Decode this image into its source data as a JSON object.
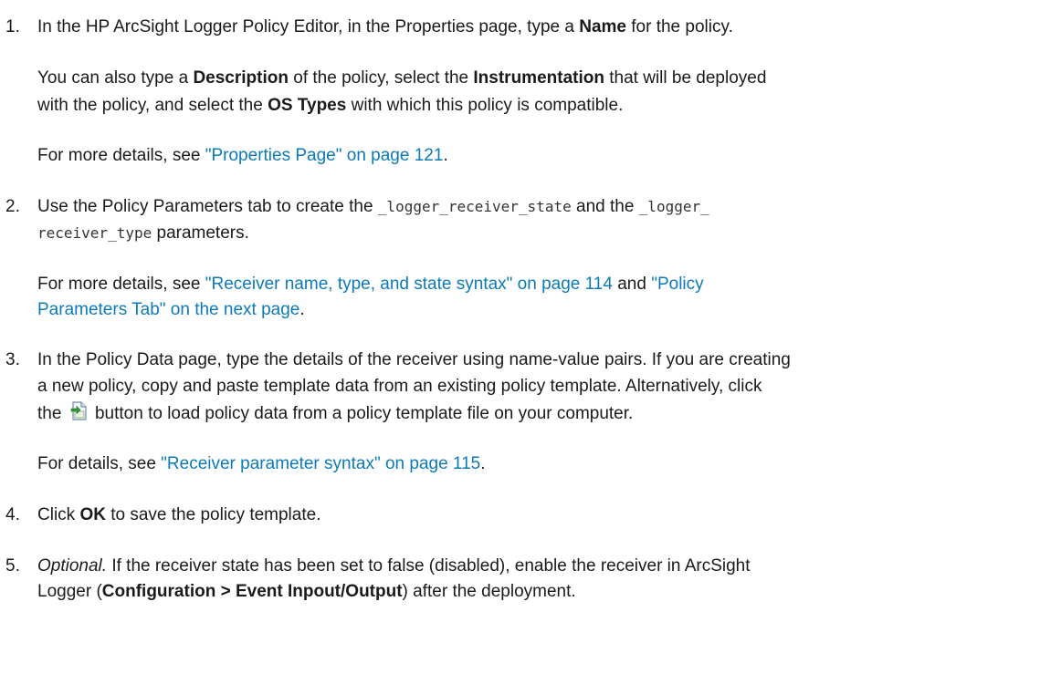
{
  "steps": [
    {
      "number": "1.",
      "line1": {
        "t1": "In the HP ArcSight Logger Policy Editor, in the Properties page, type a ",
        "b1": "Name",
        "t2": " for the policy."
      },
      "para2": {
        "l1_t1": "You can also type a ",
        "l1_b1": "Description",
        "l1_t2": " of the policy, select the ",
        "l1_b2": "Instrumentation",
        "l1_t3": " that will be deployed",
        "l2_t1": "with the policy, and select the ",
        "l2_b1": "OS Types",
        "l2_t2": " with which this policy is compatible."
      },
      "para3": {
        "t1": "For more details, see ",
        "link": "\"Properties Page\" on page 121",
        "t2": "."
      }
    },
    {
      "number": "2.",
      "line1": {
        "t1": "Use the Policy Parameters tab to create the ",
        "c1": "_logger_receiver_state",
        "t2": " and the ",
        "c2": "_logger_"
      },
      "line2": {
        "c1": "receiver_type",
        "t1": " parameters."
      },
      "para2": {
        "t1": "For more details, see ",
        "link1": "\"Receiver name, type, and state syntax\" on page 114",
        "t2": " and ",
        "link2a": "\"Policy",
        "link2b": "Parameters Tab\" on the next page",
        "t3": "."
      }
    },
    {
      "number": "3.",
      "line1": "In the Policy Data page, type the details of the receiver using name-value pairs. If you are creating",
      "line2": "a new policy, copy and paste template data from an existing policy template. Alternatively, click",
      "line3": {
        "t1": "the ",
        "icon": "load-file-icon",
        "t2": " button to load policy data from a policy template file on your computer."
      },
      "para2": {
        "t1": "For details, see ",
        "link": "\"Receiver parameter syntax\" on page 115",
        "t2": "."
      }
    },
    {
      "number": "4.",
      "line1": {
        "t1": "Click ",
        "b1": "OK",
        "t2": " to save the policy template."
      }
    },
    {
      "number": "5.",
      "line1": {
        "i1": "Optional.",
        "t1": " If the receiver state has been set to false (disabled), enable the receiver in ArcSight"
      },
      "line2": {
        "t1": "Logger (",
        "b1": "Configuration > Event Inpout/Output",
        "t2": ") after the deployment."
      }
    }
  ],
  "colors": {
    "text": "#1a1a1a",
    "link": "#0c7ab7"
  }
}
